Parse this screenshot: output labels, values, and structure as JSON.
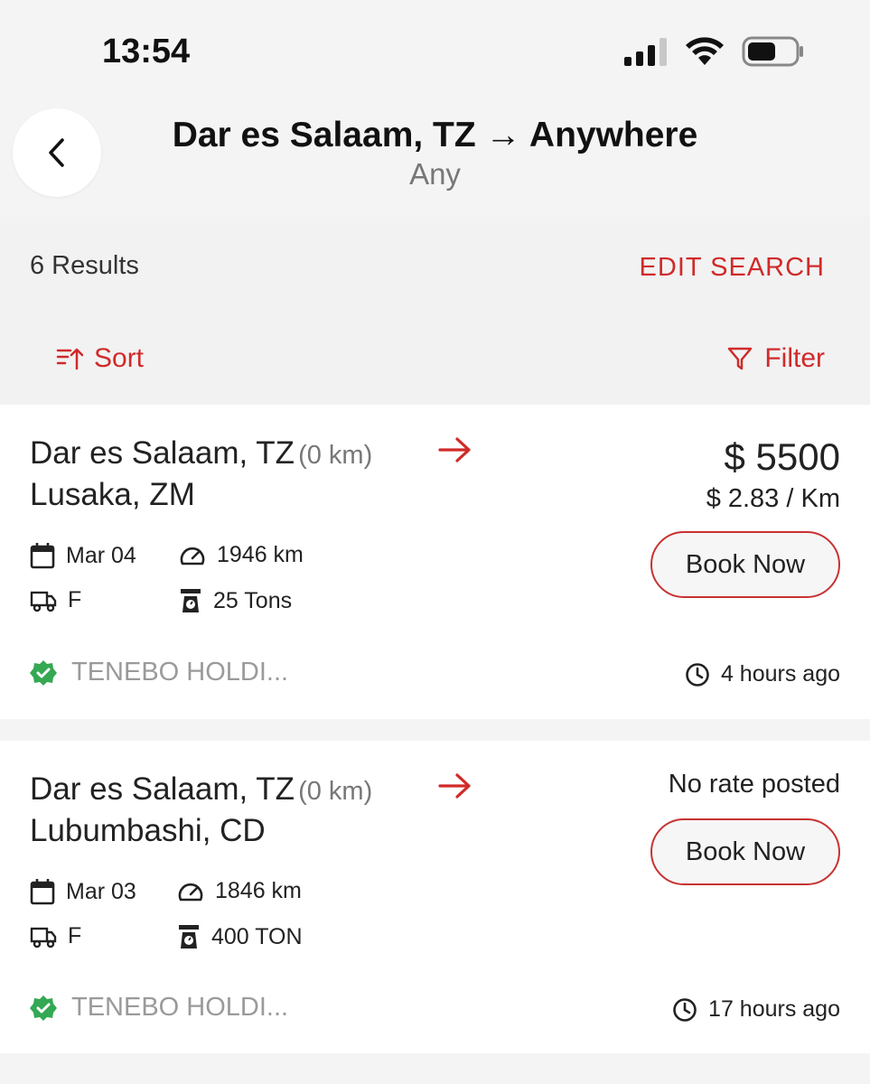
{
  "status_bar": {
    "time": "13:54"
  },
  "header": {
    "title": "Dar es Salaam, TZ → Anywhere",
    "subtitle": "Any"
  },
  "results": {
    "count_label": "6 Results",
    "edit_search_label": "EDIT SEARCH",
    "sort_label": "Sort",
    "filter_label": "Filter"
  },
  "colors": {
    "accent": "#d02a2a",
    "verified": "#34a853"
  },
  "listings": [
    {
      "origin": "Dar es Salaam, TZ",
      "origin_distance": "(0 km)",
      "destination": "Lusaka, ZM",
      "date": "Mar 04",
      "distance": "1946 km",
      "truck_type": "F",
      "weight": "25 Tons",
      "price": "$ 5500",
      "price_per_km": "$ 2.83 / Km",
      "book_label": "Book Now",
      "company": "TENEBO HOLDI...",
      "posted": "4 hours ago"
    },
    {
      "origin": "Dar es Salaam, TZ",
      "origin_distance": "(0 km)",
      "destination": "Lubumbashi, CD",
      "date": "Mar 03",
      "distance": "1846 km",
      "truck_type": "F",
      "weight": "400 TON",
      "rate_note": "No rate posted",
      "book_label": "Book Now",
      "company": "TENEBO HOLDI...",
      "posted": "17 hours ago"
    }
  ]
}
